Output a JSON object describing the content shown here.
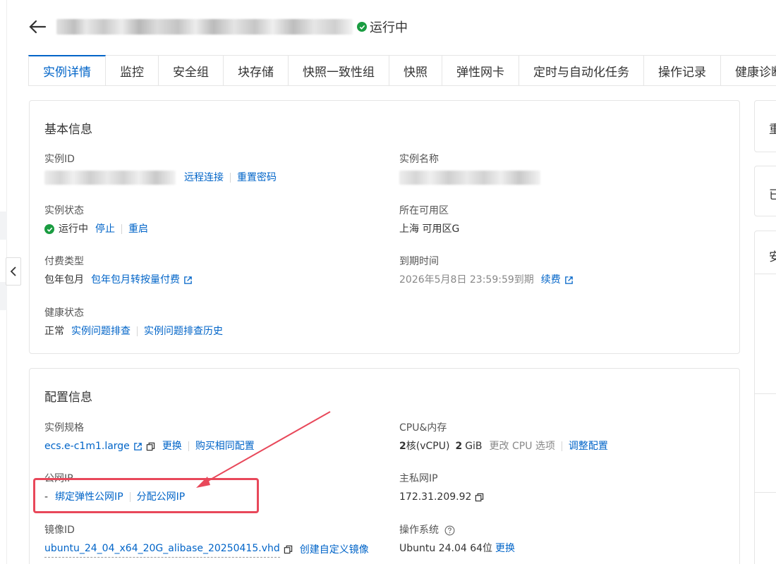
{
  "header": {
    "status": "运行中"
  },
  "tabs": [
    "实例详情",
    "监控",
    "安全组",
    "块存储",
    "快照一致性组",
    "快照",
    "弹性网卡",
    "定时与自动化任务",
    "操作记录",
    "健康诊断"
  ],
  "basic": {
    "title": "基本信息",
    "instance_id_label": "实例ID",
    "remote_connect": "远程连接",
    "reset_password": "重置密码",
    "instance_name_label": "实例名称",
    "instance_status_label": "实例状态",
    "instance_status": "运行中",
    "stop": "停止",
    "restart": "重启",
    "zone_label": "所在可用区",
    "zone": "上海 可用区G",
    "billing_label": "付费类型",
    "billing": "包年包月",
    "billing_switch": "包年包月转按量付费",
    "expire_label": "到期时间",
    "expire": "2026年5月8日 23:59:59到期",
    "renew": "续费",
    "health_label": "健康状态",
    "health": "正常",
    "troubleshoot": "实例问题排查",
    "troubleshoot_history": "实例问题排查历史"
  },
  "config": {
    "title": "配置信息",
    "spec_label": "实例规格",
    "spec": "ecs.e-c1m1.large",
    "change": "更换",
    "buy_same": "购买相同配置",
    "cpu_label": "CPU&内存",
    "cpu_value": "2",
    "cpu_unit": "核(vCPU)",
    "mem_value": "2",
    "mem_unit": "GiB",
    "change_cpu": "更改 CPU 选项",
    "adjust": "调整配置",
    "public_ip_label": "公网IP",
    "public_ip_value": "-",
    "bind_eip": "绑定弹性公网IP",
    "assign_ip": "分配公网IP",
    "private_ip_label": "主私网IP",
    "private_ip": "172.31.209.92",
    "image_label": "镜像ID",
    "image": "ubuntu_24_04_x64_20G_alibase_20250415.vhd",
    "create_image": "创建自定义镜像",
    "os_label": "操作系统",
    "os": "Ubuntu 24.04 64位",
    "os_change": "更换"
  },
  "right_cards": [
    "重",
    "已",
    "安"
  ],
  "colors": {
    "accent": "#0064c8",
    "success": "#1a9c41",
    "highlight": "#e8485a"
  }
}
